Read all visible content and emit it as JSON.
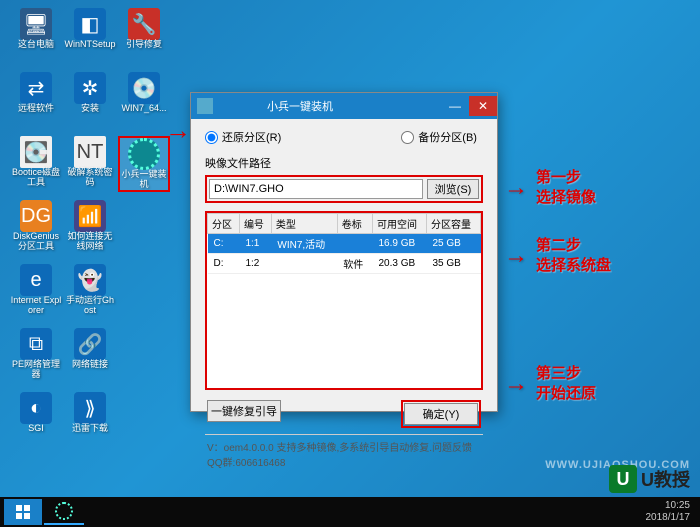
{
  "desktop": {
    "cols": [
      [
        {
          "id": "this-pc",
          "label": "这台电脑",
          "cls": "ic-computer",
          "glyph": "🖥"
        },
        {
          "id": "remote",
          "label": "远程软件",
          "cls": "ic-blue",
          "glyph": "⇄"
        },
        {
          "id": "bootice",
          "label": "Bootice磁盘工具",
          "cls": "ic-white",
          "glyph": "💽"
        },
        {
          "id": "diskgenius",
          "label": "DiskGenius分区工具",
          "cls": "ic-orange",
          "glyph": "DG"
        },
        {
          "id": "ie",
          "label": "Internet Explorer",
          "cls": "ic-blue",
          "glyph": "e"
        },
        {
          "id": "pe-net",
          "label": "PE网络管理器",
          "cls": "ic-blue",
          "glyph": "⧉"
        },
        {
          "id": "sgi",
          "label": "SGI",
          "cls": "ic-blue",
          "glyph": "◐"
        }
      ],
      [
        {
          "id": "winnt",
          "label": "WinNTSetup",
          "cls": "ic-blue",
          "glyph": "◧"
        },
        {
          "id": "install",
          "label": "安装",
          "cls": "ic-blue",
          "glyph": "✲"
        },
        {
          "id": "crackpwd",
          "label": "破解系统密码",
          "cls": "ic-white",
          "glyph": "NT"
        },
        {
          "id": "wifi",
          "label": "如何连接无线网络",
          "cls": "ic-wifi",
          "glyph": "📶"
        },
        {
          "id": "ghost",
          "label": "手动运行Ghost",
          "cls": "ic-blue",
          "glyph": "👻"
        },
        {
          "id": "netlink",
          "label": "网络链接",
          "cls": "ic-blue",
          "glyph": "🔗"
        },
        {
          "id": "xunlei",
          "label": "迅雷下载",
          "cls": "ic-blue",
          "glyph": "⟫"
        }
      ],
      [
        {
          "id": "bootfix",
          "label": "引导修复",
          "cls": "ic-red",
          "glyph": "🔧"
        },
        {
          "id": "win7",
          "label": "WIN7_64...",
          "cls": "ic-blue",
          "glyph": "💿"
        },
        {
          "id": "installer",
          "label": "小兵一键装机",
          "cls": "ic-teal",
          "glyph": "",
          "selected": true
        }
      ]
    ]
  },
  "dialog": {
    "title": "小兵一键装机",
    "radio_restore": "还原分区(R)",
    "radio_backup": "备份分区(B)",
    "file_label": "映像文件路径",
    "file_value": "D:\\WIN7.GHO",
    "browse": "浏览(S)",
    "headers": [
      "分区",
      "编号",
      "类型",
      "卷标",
      "可用空间",
      "分区容量"
    ],
    "rows": [
      {
        "p": "C:",
        "n": "1:1",
        "t": "WIN7,活动",
        "v": "",
        "f": "16.9 GB",
        "c": "25 GB",
        "sel": true
      },
      {
        "p": "D:",
        "n": "1:2",
        "t": "",
        "v": "软件",
        "f": "20.3 GB",
        "c": "35 GB",
        "sel": false
      }
    ],
    "repair_btn": "一键修复引导",
    "ok_btn": "确定(Y)",
    "version": "V：oem4.0.0.0      支持多种镜像,多系统引导自动修复.问题反馈QQ群:606616468"
  },
  "callouts": {
    "step1_title": "第一步",
    "step1_sub": "选择镜像",
    "step2_title": "第二步",
    "step2_sub": "选择系统盘",
    "step3_title": "第三步",
    "step3_sub": "开始还原"
  },
  "watermark": {
    "url": "WWW.UJIAOSHOU.COM",
    "brand": "U教授"
  },
  "tray": {
    "time": "10:25",
    "date": "2018/1/17"
  }
}
